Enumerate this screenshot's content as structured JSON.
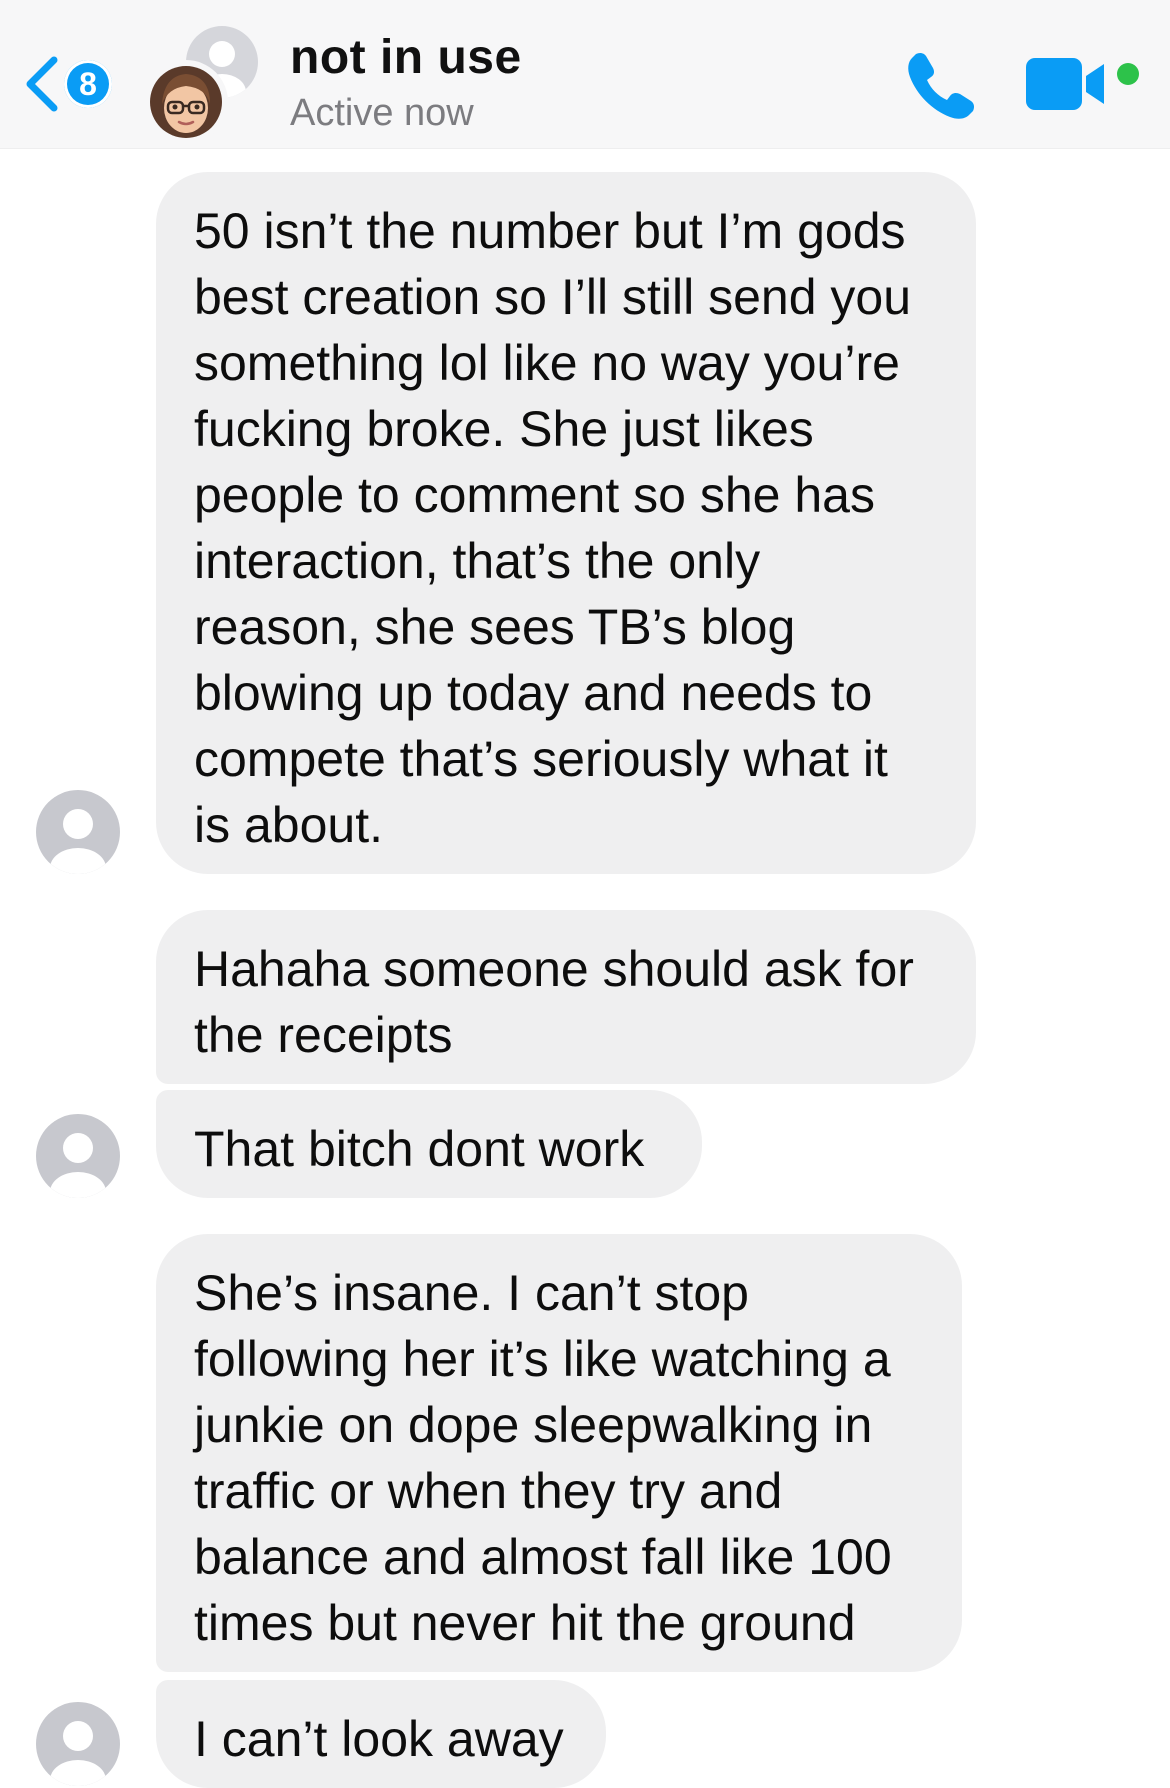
{
  "header": {
    "back_badge": "8",
    "title": "not in use",
    "status": "Active now",
    "icons": {
      "back": "chevron-left-icon",
      "call": "phone-icon",
      "video": "video-camera-icon",
      "online": "online-dot-icon"
    },
    "accent_color": "#0a9cf5",
    "online_color": "#2dc24a"
  },
  "messages": [
    {
      "text": "50 isn’t the number but I’m gods\nbest creation so I’ll still send you\nsomething lol like no way you’re\nfucking broke. She just likes\npeople to comment so she has\ninteraction, that’s the only\nreason, she sees TB’s blog\nblowing up today and needs to\ncompete that’s seriously what it\nis about."
    },
    {
      "text": "Hahaha someone should ask for\nthe receipts"
    },
    {
      "text": "That bitch dont work"
    },
    {
      "text": "She’s insane. I can’t stop\nfollowing her it’s like watching a\njunkie on dope sleepwalking in\ntraffic or when they try and\nbalance and almost fall like 100\ntimes but never hit the ground"
    },
    {
      "text": "I can’t look away"
    }
  ],
  "colors": {
    "bubble_bg": "#efeff0",
    "avatar_placeholder": "#c7c8ce",
    "header_bg": "#f7f7f8"
  }
}
